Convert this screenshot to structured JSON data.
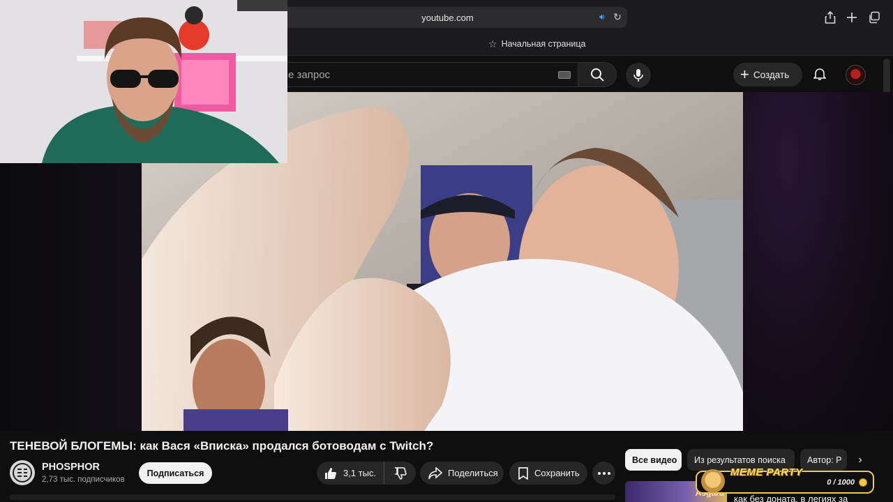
{
  "browser": {
    "url": "youtube.com",
    "bookmark_label": "Начальная страница"
  },
  "header": {
    "search_placeholder": "е запрос",
    "create_label": "Создать"
  },
  "video": {
    "title": "ТЕНЕВОЙ БЛОГЕМЫ: как Вася «Вписка» продался ботоводам с Twitch?",
    "channel_name": "PHOSPHOR",
    "subscribers": "2,73 тыс. подписчиков",
    "subscribe_label": "Подписаться",
    "likes": "3,1 тыс.",
    "share_label": "Поделиться",
    "save_label": "Сохранить"
  },
  "chips": [
    {
      "label": "Все видео",
      "active": true
    },
    {
      "label": "Из результатов поиска",
      "active": false
    },
    {
      "label": "Автор: P",
      "active": false
    }
  ],
  "overlay": {
    "meme_title": "MEME PARTY",
    "meme_count": "0 / 1000"
  },
  "recommendation": {
    "thumb_text": "Asgard",
    "title_fragment": "как без доната, в легиях за"
  },
  "colors": {
    "background": "#0f0f0f",
    "accent_yellow": "#f2c94c",
    "chip_active": "#f1f1f1"
  }
}
